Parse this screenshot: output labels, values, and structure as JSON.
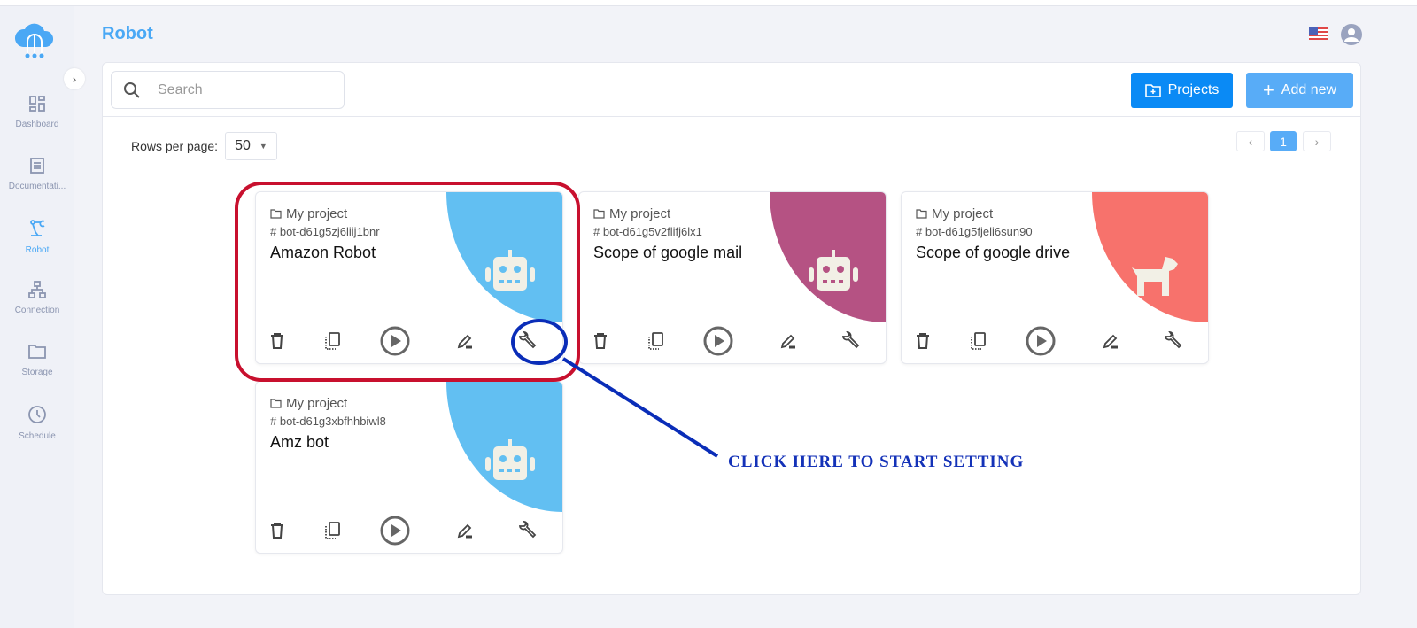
{
  "header": {
    "title": "Robot",
    "language": "en-US",
    "flag_icon": "us-flag-icon",
    "avatar_icon": "user-icon"
  },
  "sidebar": {
    "items": [
      {
        "label": "Dashboard",
        "icon": "dashboard-icon",
        "active": false
      },
      {
        "label": "Documentati...",
        "icon": "document-icon",
        "active": false
      },
      {
        "label": "Robot",
        "icon": "robot-arm-icon",
        "active": true
      },
      {
        "label": "Connection",
        "icon": "sitemap-icon",
        "active": false
      },
      {
        "label": "Storage",
        "icon": "folder-icon",
        "active": false
      },
      {
        "label": "Schedule",
        "icon": "clock-icon",
        "active": false
      }
    ]
  },
  "toolbar": {
    "search_placeholder": "Search",
    "search_value": "",
    "projects_label": "Projects",
    "add_new_label": "Add new"
  },
  "pagination": {
    "rows_per_page_label": "Rows per page:",
    "rows_per_page": "50",
    "current_page": "1"
  },
  "cards": [
    {
      "project": "My project",
      "id": "bot-d61g5zj6liij1bnr",
      "name": "Amazon Robot",
      "color": "#62bff2",
      "icon": "robot"
    },
    {
      "project": "My project",
      "id": "bot-d61g5v2flifj6lx1",
      "name": "Scope of google mail",
      "color": "#b55283",
      "icon": "robot"
    },
    {
      "project": "My project",
      "id": "bot-d61g5fjeli6sun90",
      "name": "Scope of google drive",
      "color": "#f7726c",
      "icon": "dog"
    },
    {
      "project": "My project",
      "id": "bot-d61g3xbfhhbiwl8",
      "name": "Amz bot",
      "color": "#62bff2",
      "icon": "robot"
    }
  ],
  "annotation": {
    "text": "CLICK HERE TO START SETTING",
    "highlight_color": "#c8102e",
    "pointer_color": "#0a2db8"
  }
}
